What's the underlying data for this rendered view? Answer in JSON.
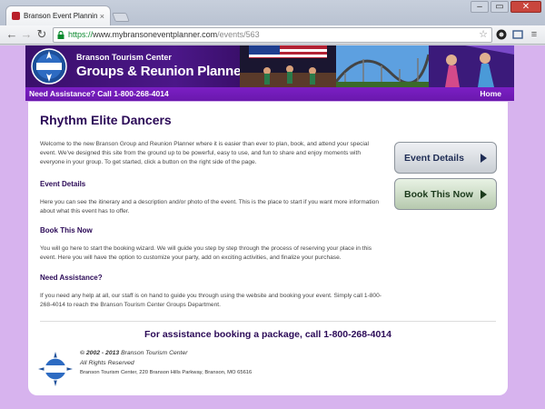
{
  "browser": {
    "tab_title": "Branson Event Planning S",
    "url_scheme": "https://",
    "url_host": "www.mybransoneventplanner.com",
    "url_path": "/events/563",
    "minimize": "–",
    "restore": "▭",
    "close": "✕"
  },
  "banner": {
    "subtitle": "Branson Tourism Center",
    "title": "Groups & Reunion Planner"
  },
  "assistbar": {
    "text": "Need Assistance? Call 1-800-268-4014",
    "home": "Home"
  },
  "content": {
    "title": "Rhythm Elite Dancers",
    "intro": "Welcome to the new Branson Group and Reunion Planner where it is easier than ever to plan, book, and attend your special event. We've designed this site from the ground up to be powerful, easy to use, and fun to share and enjoy moments with everyone in your group. To get started, click a button on the right side of the page.",
    "h_details": "Event Details",
    "p_details": "Here you can see the itinerary and a description and/or photo of the event. This is the place to start if you want more information about what this event has to offer.",
    "h_book": "Book This Now",
    "p_book": "You will go here to start the booking wizard. We will guide you step by step through the process of reserving your place in this event. Here you will have the option to customize your party, add on exciting activities, and finalize your purchase.",
    "h_assist": "Need Assistance?",
    "p_assist": "If you need any help at all, our staff is on hand to guide you through using the website and booking your event. Simply call 1-800-268-4014 to reach the Branson Tourism Center Groups Department."
  },
  "buttons": {
    "details": "Event Details",
    "book": "Book This Now"
  },
  "footer": {
    "callout": "For assistance booking a package, call 1-800-268-4014",
    "copyright_bold": "© 2002 - 2013",
    "copyright_rest": " Branson Tourism Center",
    "rights": "All Rights Reserved",
    "address": "Branson Tourism Center, 220 Branson Hills Parkway, Branson, MO 65616"
  },
  "colors": {
    "purple_dark": "#2b0a57",
    "purple_bar": "#6a18ad",
    "page_bg": "#d7b3ee",
    "url_green": "#0b8a2e"
  }
}
